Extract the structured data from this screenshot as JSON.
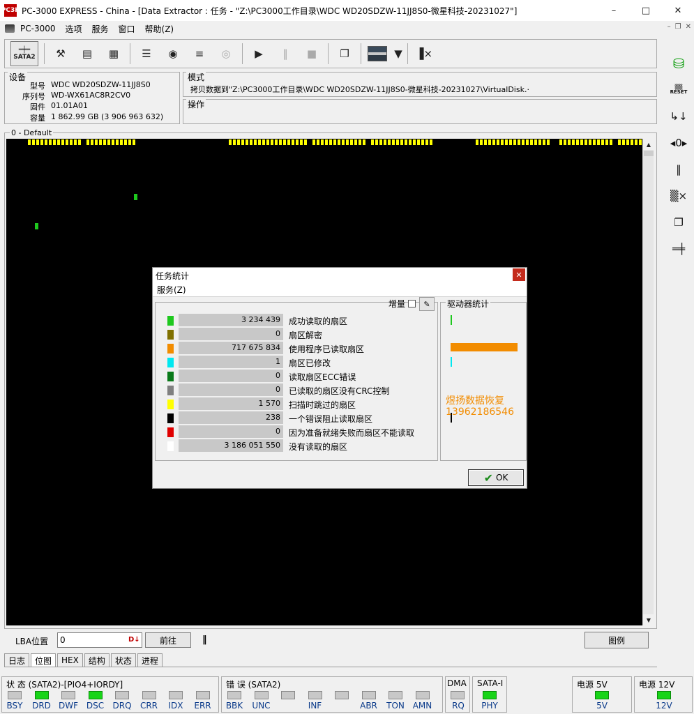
{
  "window": {
    "title": "PC-3000 EXPRESS - China - [Data Extractor : 任务 - \"Z:\\PC3000工作目录\\WDC WD20SDZW-11JJ8S0-微星科技-20231027\"]",
    "icon_text": "PC3K"
  },
  "menu": {
    "items": [
      "PC-3000",
      "选项",
      "服务",
      "窗口",
      "帮助(Z)"
    ]
  },
  "toolbar": {
    "sata_label": "SATA2",
    "tools": [
      "tools-icon",
      "bios-icon",
      "percent-icon",
      "module-icon",
      "binoculars-icon",
      "disk-stack-icon",
      "disk-grey-icon",
      "play-icon",
      "pause-icon",
      "stop-icon",
      "copy-icon",
      "thumbnail",
      "dropdown-arrow",
      "exit-icon"
    ]
  },
  "device": {
    "label": "设备",
    "rows": [
      {
        "key": "型号",
        "value": "WDC WD20SDZW-11JJ8S0"
      },
      {
        "key": "序列号",
        "value": "WD-WX61AC8R2CV0"
      },
      {
        "key": "固件",
        "value": "01.01A01"
      },
      {
        "key": "容量",
        "value": "1 862.99 GB (3 906 963 632)"
      }
    ]
  },
  "mode": {
    "label": "模式",
    "text": "拷贝数据到\"Z:\\PC3000工作目录\\WDC WD20SDZW-11JJ8S0-微星科技-20231027\\VirtualDisk.·"
  },
  "operation": {
    "label": "操作"
  },
  "map": {
    "label": "0 - Default",
    "colors": {
      "read_by_program": "#f28c00",
      "skipped": "#ffff00",
      "error": "#000000",
      "success": "#1ec81e"
    }
  },
  "lba": {
    "label": "LBA位置",
    "value": "0",
    "goto_label": "前往",
    "legend_label": "图例"
  },
  "tabs": [
    "日志",
    "位图",
    "HEX",
    "结构",
    "状态",
    "进程"
  ],
  "status": {
    "state_title": "状 态 (SATA2)-[PIO4+IORDY]",
    "state_leds": [
      {
        "label": "BSY",
        "on": false
      },
      {
        "label": "DRD",
        "on": true
      },
      {
        "label": "DWF",
        "on": false
      },
      {
        "label": "DSC",
        "on": true
      },
      {
        "label": "DRQ",
        "on": false
      },
      {
        "label": "CRR",
        "on": false
      },
      {
        "label": "IDX",
        "on": false
      },
      {
        "label": "ERR",
        "on": false
      }
    ],
    "error_title": "错 误 (SATA2)",
    "error_leds": [
      {
        "label": "BBK",
        "on": false
      },
      {
        "label": "UNC",
        "on": false
      },
      {
        "label": "",
        "on": false
      },
      {
        "label": "INF",
        "on": false
      },
      {
        "label": "",
        "on": false
      },
      {
        "label": "ABR",
        "on": false
      },
      {
        "label": "TON",
        "on": false
      },
      {
        "label": "AMN",
        "on": false
      }
    ],
    "dma_title": "DMA",
    "dma_led": {
      "label": "RQ",
      "on": false
    },
    "sata_title": "SATA-I",
    "sata_led": {
      "label": "PHY",
      "on": true
    },
    "power5_title": "电源 5V",
    "power5_led": {
      "label": "5V",
      "on": true
    },
    "power12_title": "电源 12V",
    "power12_led": {
      "label": "12V",
      "on": true
    }
  },
  "dialog": {
    "title": "任务统计",
    "menu_label": "服务(Z)",
    "increment_label": "增量",
    "drive_stats_label": "驱动器统计",
    "ok_label": "OK",
    "watermark_line1": "煜扬数据恢复",
    "watermark_line2": "13962186546",
    "stats": [
      {
        "value": "3 234 439",
        "label": "成功读取的扇区",
        "color": "#1ec81e",
        "bar_fraction": 0.02
      },
      {
        "value": "0",
        "label": "扇区解密",
        "color": "#807000",
        "bar_fraction": 0
      },
      {
        "value": "717 675 834",
        "label": "使用程序已读取扇区",
        "color": "#f28c00",
        "bar_fraction": 1.0
      },
      {
        "value": "1",
        "label": "扇区已修改",
        "color": "#00e8f0",
        "bar_fraction": 0.02
      },
      {
        "value": "0",
        "label": "读取扇区ECC错误",
        "color": "#0a7a1a",
        "bar_fraction": 0
      },
      {
        "value": "0",
        "label": "已读取的扇区没有CRC控制",
        "color": "#808080",
        "bar_fraction": 0
      },
      {
        "value": "1 570",
        "label": "扫描时跳过的扇区",
        "color": "#ffff00",
        "bar_fraction": 0
      },
      {
        "value": "238",
        "label": "一个错误阻止读取扇区",
        "color": "#000000",
        "bar_fraction": 0.01
      },
      {
        "value": "0",
        "label": "因为准备就绪失败而扇区不能读取",
        "color": "#e00000",
        "bar_fraction": 0
      },
      {
        "value": "3 186 051 550",
        "label": "没有读取的扇区",
        "color": "#ffffff",
        "bar_fraction": 0
      }
    ]
  }
}
